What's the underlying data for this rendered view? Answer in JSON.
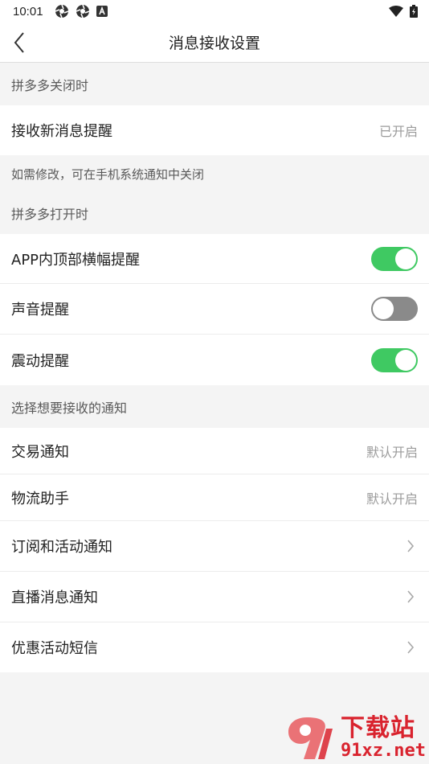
{
  "status_bar": {
    "time": "10:01"
  },
  "header": {
    "title": "消息接收设置"
  },
  "section_closed": {
    "header": "拼多多关闭时",
    "rows": [
      {
        "label": "接收新消息提醒",
        "value": "已开启"
      }
    ],
    "note": "如需修改，可在手机系统通知中关闭"
  },
  "section_open": {
    "header": "拼多多打开时",
    "rows": [
      {
        "label": "APP内顶部横幅提醒",
        "toggle": "on"
      },
      {
        "label": "声音提醒",
        "toggle": "off"
      },
      {
        "label": "震动提醒",
        "toggle": "on"
      }
    ]
  },
  "section_notify": {
    "header": "选择想要接收的通知",
    "rows": [
      {
        "label": "交易通知",
        "value": "默认开启"
      },
      {
        "label": "物流助手",
        "value": "默认开启"
      },
      {
        "label": "订阅和活动通知",
        "icon": "chevron-right-icon"
      },
      {
        "label": "直播消息通知",
        "icon": "chevron-right-icon"
      },
      {
        "label": "优惠活动短信",
        "icon": "chevron-right-icon"
      }
    ]
  },
  "watermark": {
    "brand": "下载站",
    "url": "91xz.net"
  },
  "colors": {
    "toggle_on": "#3fc962",
    "toggle_off": "#8a8a8a",
    "watermark": "#d9232e"
  }
}
